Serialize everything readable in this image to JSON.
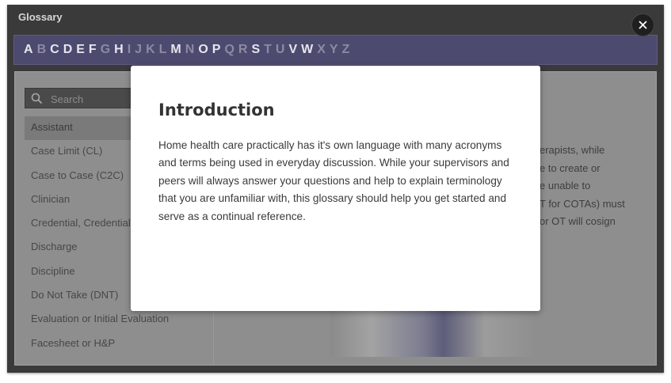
{
  "window": {
    "title": "Glossary"
  },
  "letters": [
    {
      "char": "A",
      "enabled": true
    },
    {
      "char": "B",
      "enabled": false
    },
    {
      "char": "C",
      "enabled": true
    },
    {
      "char": "D",
      "enabled": true
    },
    {
      "char": "E",
      "enabled": true
    },
    {
      "char": "F",
      "enabled": true
    },
    {
      "char": "G",
      "enabled": false
    },
    {
      "char": "H",
      "enabled": true
    },
    {
      "char": "I",
      "enabled": false
    },
    {
      "char": "J",
      "enabled": false
    },
    {
      "char": "K",
      "enabled": false
    },
    {
      "char": "L",
      "enabled": false
    },
    {
      "char": "M",
      "enabled": true
    },
    {
      "char": "N",
      "enabled": false
    },
    {
      "char": "O",
      "enabled": true
    },
    {
      "char": "P",
      "enabled": true
    },
    {
      "char": "Q",
      "enabled": false
    },
    {
      "char": "R",
      "enabled": false
    },
    {
      "char": "S",
      "enabled": true
    },
    {
      "char": "T",
      "enabled": false
    },
    {
      "char": "U",
      "enabled": false
    },
    {
      "char": "V",
      "enabled": true
    },
    {
      "char": "W",
      "enabled": true
    },
    {
      "char": "X",
      "enabled": false
    },
    {
      "char": "Y",
      "enabled": false
    },
    {
      "char": "Z",
      "enabled": false
    }
  ],
  "search": {
    "placeholder": "Search"
  },
  "terms": [
    {
      "label": "Assistant",
      "active": true
    },
    {
      "label": "Case Limit (CL)",
      "active": false
    },
    {
      "label": "Case to Case (C2C)",
      "active": false
    },
    {
      "label": "Clinician",
      "active": false
    },
    {
      "label": "Credential, Credential",
      "active": false
    },
    {
      "label": "Discharge",
      "active": false
    },
    {
      "label": "Discipline",
      "active": false
    },
    {
      "label": "Do Not Take (DNT)",
      "active": false
    },
    {
      "label": "Evaluation or Initial Evaluation",
      "active": false
    },
    {
      "label": "Facesheet or H&P",
      "active": false
    }
  ],
  "detail_fragments": [
    "erapists, while",
    "e to create or",
    "e unable to",
    "T for COTAs) must",
    " or OT will cosign"
  ],
  "modal": {
    "title": "Introduction",
    "body_lines": [
      "Home health care practically has it's own language with many acronyms",
      "and terms being used in everyday discussion.  While your supervisors and",
      "peers will always answer your questions and help to explain terminology",
      "that you are unfamiliar with, this glossary should help you get started and",
      "serve as a continual reference."
    ]
  },
  "colors": {
    "frame": "#3a3a3a",
    "letter_bar": "#4c4a6e",
    "letter_enabled": "#e6e6ee",
    "letter_disabled": "#8c8aa4",
    "overlay_panel": "#8e8e8e"
  },
  "icons": {
    "search": "search-icon",
    "close": "close-icon"
  }
}
